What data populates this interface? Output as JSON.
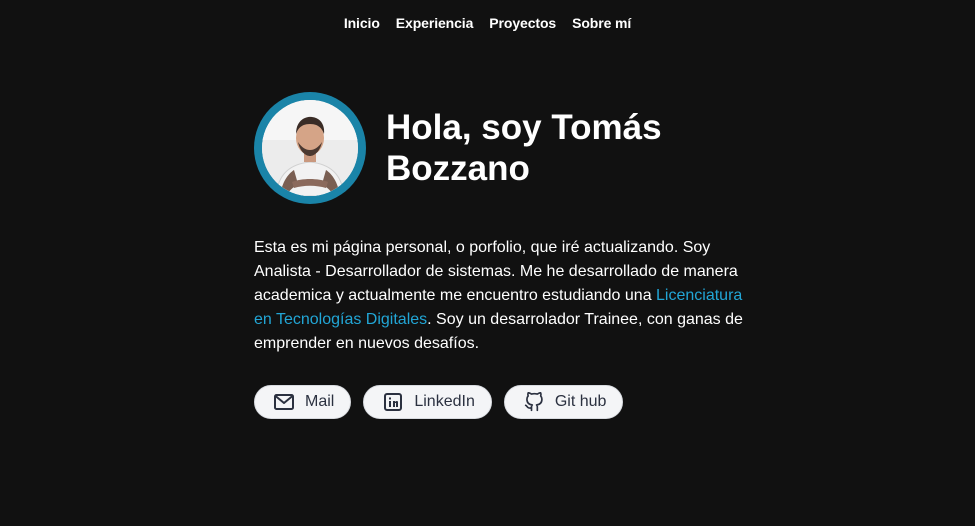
{
  "nav": {
    "items": [
      {
        "label": "Inicio"
      },
      {
        "label": "Experiencia"
      },
      {
        "label": "Proyectos"
      },
      {
        "label": "Sobre mí"
      }
    ]
  },
  "hero": {
    "title": "Hola, soy Tomás Bozzano",
    "bio_part1": "Esta es mi página personal, o porfolio, que iré actualizando. Soy Analista - Desarrollador de sistemas. Me he desarrollado de manera academica y actualmente me encuentro estudiando una ",
    "bio_link": "Licenciatura en Tecnologías Digitales",
    "bio_part2": ". Soy un desarrolador Trainee, con ganas de emprender en nuevos desafíos."
  },
  "buttons": {
    "mail": {
      "label": "Mail",
      "icon": "mail-icon"
    },
    "linkedin": {
      "label": "LinkedIn",
      "icon": "linkedin-icon"
    },
    "github": {
      "label": "Git hub",
      "icon": "github-icon"
    }
  },
  "colors": {
    "background": "#111111",
    "accent": "#22a6d6",
    "avatar_ring": "#1a84a8"
  }
}
